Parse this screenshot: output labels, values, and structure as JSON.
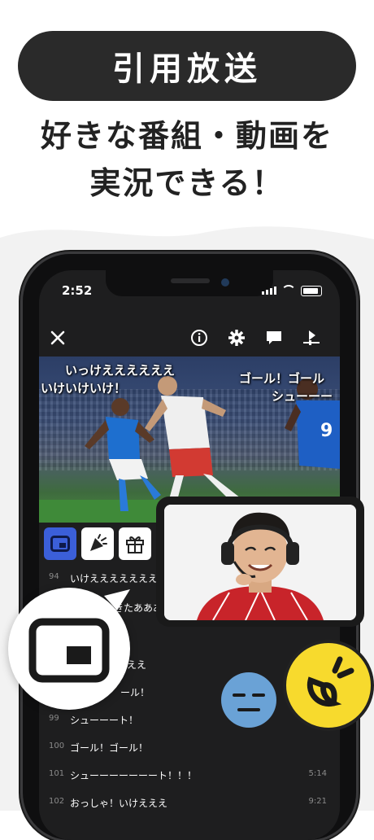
{
  "banner": {
    "label": "引用放送"
  },
  "headline": {
    "line1": "好きな番組・動画を",
    "line2": "実況できる！"
  },
  "status_bar": {
    "time": "2:52"
  },
  "video": {
    "comments": [
      {
        "text": "いっけええええええ"
      },
      {
        "text": "いけいけいけ！"
      },
      {
        "text": "ゴール！ゴール"
      },
      {
        "text": "シューーー"
      }
    ]
  },
  "chat": {
    "rows": [
      {
        "num": "94",
        "text": "いけえええええええ",
        "time": ""
      },
      {
        "num": "",
        "text": "きたあああああ",
        "time": ""
      },
      {
        "num": "",
        "text": "",
        "time": ""
      },
      {
        "num": "",
        "text": "ええ",
        "time": ""
      },
      {
        "num": "",
        "text": "ール！",
        "time": ""
      },
      {
        "num": "99",
        "text": "シューーート！",
        "time": ""
      },
      {
        "num": "100",
        "text": "ゴール！ゴール！",
        "time": ""
      },
      {
        "num": "101",
        "text": "シューーーーーーート！！！",
        "time": "5:14"
      },
      {
        "num": "102",
        "text": "おっしゃ！いけえええ",
        "time": "9:21"
      }
    ]
  },
  "colors": {
    "accent_blue": "#3b5fd9",
    "pill_bg": "#2a2a2a",
    "yellow": "#f7da2d",
    "face_blue": "#6aa2d6"
  }
}
